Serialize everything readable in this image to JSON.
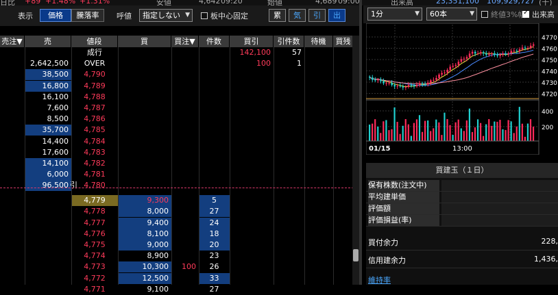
{
  "topstrip": {
    "a": "日比",
    "b": "+89",
    "c": "+1.48%",
    "d": "+1.31%",
    "e": "安値",
    "f": "4,642",
    "g": "09:20",
    "h": "始値",
    "i": "4,689",
    "j": "09:00",
    "k": "出来高",
    "l": "23,351,100",
    "m": "109,929,727",
    "n": "(千)"
  },
  "toolbar": {
    "display_label": "表示",
    "price_btn": "価格",
    "rate_btn": "騰落率",
    "quote_label": "呼値",
    "quote_select": "指定しない",
    "center_fix": "板中心固定",
    "mode_buttons": [
      "累",
      "気",
      "引",
      "出"
    ]
  },
  "board": {
    "headers": [
      "売注▼",
      "売",
      "値段",
      "買",
      "買注▼",
      "件数",
      "買引",
      "引件数",
      "待機",
      "買残"
    ],
    "market_row": {
      "price": "成行",
      "buy_yori": "142,100",
      "yori_count": "57"
    },
    "over_row": {
      "sell": "2,642,500",
      "price": "OVER",
      "buy_yori": "100",
      "yori_count": "1"
    },
    "sell_rows": [
      {
        "sell": "38,500",
        "price": "4,790",
        "hl": true
      },
      {
        "sell": "16,800",
        "price": "4,789",
        "hl": true
      },
      {
        "sell": "16,100",
        "price": "4,788",
        "hl": false
      },
      {
        "sell": "7,600",
        "price": "4,787",
        "hl": false
      },
      {
        "sell": "8,500",
        "price": "4,786",
        "hl": false
      },
      {
        "sell": "35,700",
        "price": "4,785",
        "hl": true
      },
      {
        "sell": "14,400",
        "price": "4,784",
        "hl": false
      },
      {
        "sell": "17,600",
        "price": "4,783",
        "hl": false
      },
      {
        "sell": "14,100",
        "price": "4,782",
        "hl": true
      },
      {
        "sell": "6,000",
        "price": "4,781",
        "hl": true
      },
      {
        "sell": "96,500",
        "price": "4,780",
        "hl": true,
        "mark": "引"
      }
    ],
    "buy_rows": [
      {
        "price": "4,779",
        "buy": "9,300",
        "buy_order": "",
        "count": "5",
        "gold": true
      },
      {
        "price": "4,778",
        "buy": "8,000",
        "buy_order": "",
        "count": "27"
      },
      {
        "price": "4,777",
        "buy": "9,400",
        "buy_order": "",
        "count": "24"
      },
      {
        "price": "4,776",
        "buy": "8,100",
        "buy_order": "",
        "count": "18"
      },
      {
        "price": "4,775",
        "buy": "9,000",
        "buy_order": "",
        "count": "20"
      },
      {
        "price": "4,774",
        "buy": "8,900",
        "buy_order": "",
        "count": "23"
      },
      {
        "price": "4,773",
        "buy": "10,300",
        "buy_order": "100",
        "count": "26"
      },
      {
        "price": "4,772",
        "buy": "12,500",
        "buy_order": "",
        "count": "33"
      },
      {
        "price": "4,771",
        "buy": "9,100",
        "buy_order": "",
        "count": "27"
      }
    ]
  },
  "right": {
    "interval": "1分",
    "bars": "60本",
    "close_3pct": "終値3%幅",
    "volume_high": "出来高",
    "price_ticks": [
      "4770",
      "4760",
      "4750",
      "4740",
      "4730",
      "4720"
    ],
    "vol_ticks": [
      "400",
      "200"
    ],
    "date_label": "01/15",
    "time_label": "13:00",
    "position_title": "買建玉（１日）",
    "position_rows": [
      "保有株数(注文中)",
      "平均建単価",
      "評価額",
      "評価損益(率)"
    ],
    "buy_power_label": "買付余力",
    "buy_power_value": "228,",
    "margin_power_label": "信用建余力",
    "margin_power_value": "1,436,",
    "maintenance_link": "維持率"
  },
  "colors": {
    "red": "#ff3b5a",
    "blue": "#4aa8ff",
    "highlight": "#133e7f",
    "gold": "#7a6a22"
  }
}
